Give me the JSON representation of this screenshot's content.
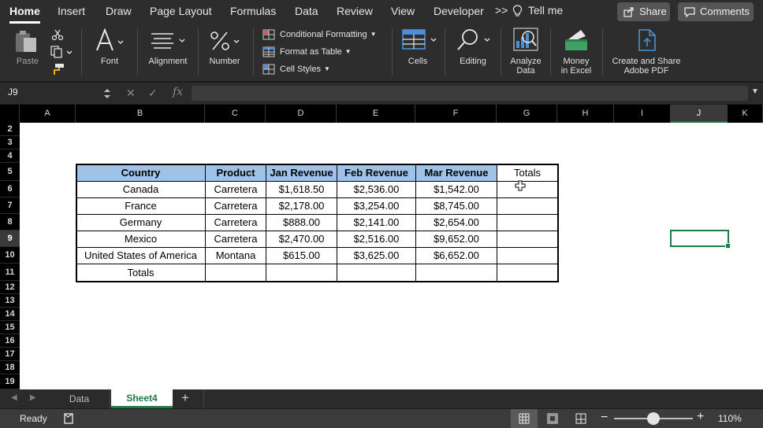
{
  "ribbon_tabs": [
    "Home",
    "Insert",
    "Draw",
    "Page Layout",
    "Formulas",
    "Data",
    "Review",
    "View",
    "Developer"
  ],
  "more_tabs": ">>",
  "tell_me": "Tell me",
  "share_label": "Share",
  "comments_label": "Comments",
  "ribbon": {
    "paste": "Paste",
    "font": "Font",
    "alignment": "Alignment",
    "number": "Number",
    "conditional_formatting": "Conditional Formatting",
    "format_as_table": "Format as Table",
    "cell_styles": "Cell Styles",
    "cells": "Cells",
    "editing": "Editing",
    "analyze_data": [
      "Analyze",
      "Data"
    ],
    "money_in_excel": [
      "Money",
      "in Excel"
    ],
    "create_share_pdf": [
      "Create and Share",
      "Adobe PDF"
    ]
  },
  "name_box": "J9",
  "formula_value": "",
  "fx": "fx",
  "columns": [
    "A",
    "B",
    "C",
    "D",
    "E",
    "F",
    "G",
    "H",
    "I",
    "J",
    "K"
  ],
  "selected_column": "J",
  "rows": [
    "2",
    "3",
    "4",
    "5",
    "6",
    "7",
    "8",
    "9",
    "10",
    "11",
    "12",
    "13",
    "14",
    "15",
    "16",
    "17",
    "18",
    "19"
  ],
  "selected_row": "9",
  "table": {
    "headers": [
      "Country",
      "Product",
      "Jan Revenue",
      "Feb Revenue",
      "Mar Revenue"
    ],
    "totals_header": "Totals",
    "rows": [
      [
        "Canada",
        "Carretera",
        "$1,618.50",
        "$2,536.00",
        "$1,542.00"
      ],
      [
        "France",
        "Carretera",
        "$2,178.00",
        "$3,254.00",
        "$8,745.00"
      ],
      [
        "Germany",
        "Carretera",
        "$888.00",
        "$2,141.00",
        "$2,654.00"
      ],
      [
        "Mexico",
        "Carretera",
        "$2,470.00",
        "$2,516.00",
        "$9,652.00"
      ],
      [
        "United States of America",
        "Montana",
        "$615.00",
        "$3,625.00",
        "$6,652.00"
      ]
    ],
    "totals_row_label": "Totals"
  },
  "sheet_tabs": [
    "Data",
    "Sheet4"
  ],
  "active_sheet": "Sheet4",
  "add_sheet": "+",
  "status": "Ready",
  "zoom": "110%",
  "zoom_level": 0.5,
  "colors": {
    "accent": "#1f7a45",
    "header_fill": "#9fc3e7"
  }
}
